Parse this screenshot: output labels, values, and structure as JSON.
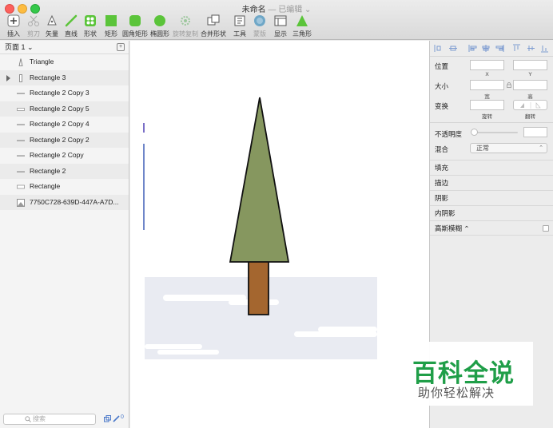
{
  "window": {
    "title": "未命名",
    "subtitle": "— 已编辑 ⌄"
  },
  "toolbar": {
    "insert": "插入",
    "scissors": "剪刀",
    "vector": "矢量",
    "line": "直线",
    "shape": "形状",
    "rectangle": "矩形",
    "rounded_rect": "圆角矩形",
    "oval": "椭圆形",
    "rotate_copy": "旋转复制",
    "combine": "合并形状",
    "tools": "工具",
    "mask": "蒙版",
    "display": "显示",
    "triangle": "三角形"
  },
  "layers": {
    "page": "页面 1 ⌄",
    "items": [
      {
        "label": "Triangle",
        "icon": "triangle-icon"
      },
      {
        "label": "Rectangle 3",
        "icon": "rect-vertical-icon"
      },
      {
        "label": "Rectangle 2 Copy 3",
        "icon": "line-icon"
      },
      {
        "label": "Rectangle 2 Copy 5",
        "icon": "rect-thin-icon"
      },
      {
        "label": "Rectangle 2 Copy 4",
        "icon": "line-icon"
      },
      {
        "label": "Rectangle 2 Copy 2",
        "icon": "line-icon"
      },
      {
        "label": "Rectangle 2 Copy",
        "icon": "line-icon"
      },
      {
        "label": "Rectangle 2",
        "icon": "line-icon"
      },
      {
        "label": "Rectangle",
        "icon": "rect-thin-icon"
      },
      {
        "label": "7750C728-639D-447A-A7D...",
        "icon": "image-icon"
      }
    ],
    "search_placeholder": "搜索",
    "slice_count": "0"
  },
  "inspector": {
    "position": "位置",
    "x_label": "X",
    "y_label": "Y",
    "size": "大小",
    "width_label": "宽",
    "height_label": "高",
    "transform": "变换",
    "rotate_label": "旋转",
    "flip_label": "翻转",
    "opacity": "不透明度",
    "blend": "混合",
    "blend_value": "正常",
    "fill": "填充",
    "border": "描边",
    "shadow": "阴影",
    "inner_shadow": "内阴影",
    "gaussian_blur": "高斯模糊 ⌃"
  },
  "watermark": {
    "title": "百科全说",
    "subtitle": "助你轻松解决"
  },
  "colors": {
    "tree_green": "#86975f",
    "trunk_brown": "#a4662f",
    "snow": "#e9ebf2",
    "selection_blue": "#6f86c9",
    "toolbar_green": "#5bc43a",
    "watermark_green": "#1f9e48"
  }
}
